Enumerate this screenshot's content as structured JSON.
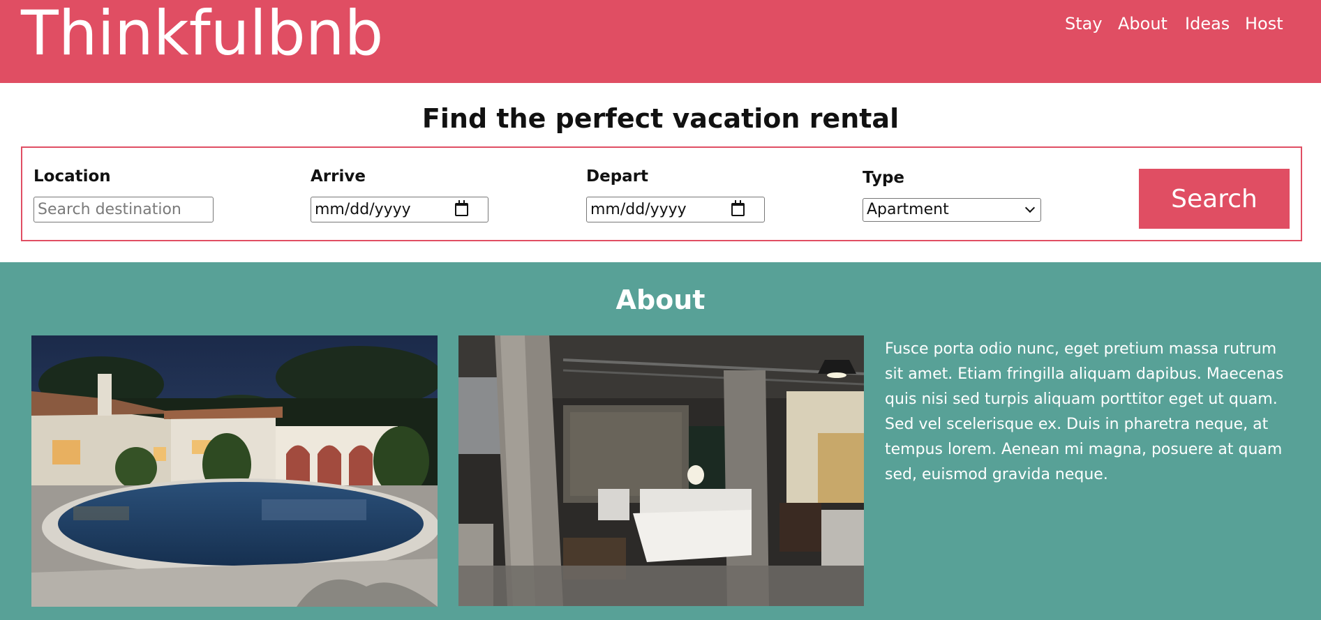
{
  "header": {
    "logo": "Thinkfulbnb",
    "nav": [
      "Stay",
      "About",
      "Ideas",
      "Host"
    ]
  },
  "headline": "Find the perfect vacation rental",
  "search": {
    "location_label": "Location",
    "location_placeholder": "Search destination",
    "arrive_label": "Arrive",
    "arrive_value": "mm/dd/yyyy",
    "depart_label": "Depart",
    "depart_value": "mm/dd/yyyy",
    "type_label": "Type",
    "type_selected": "Apartment",
    "button_label": "Search"
  },
  "about": {
    "title": "About",
    "text": "Fusce porta odio nunc, eget pretium massa rutrum sit amet. Etiam fringilla aliquam dapibus. Maecenas quis nisi sed turpis aliquam porttitor eget ut quam. Sed vel scelerisque ex. Duis in pharetra neque, at tempus lorem. Aenean mi magna, posuere at quam sed, euismod gravida neque."
  },
  "colors": {
    "brand": "#e04e63",
    "about_bg": "#58a197"
  }
}
